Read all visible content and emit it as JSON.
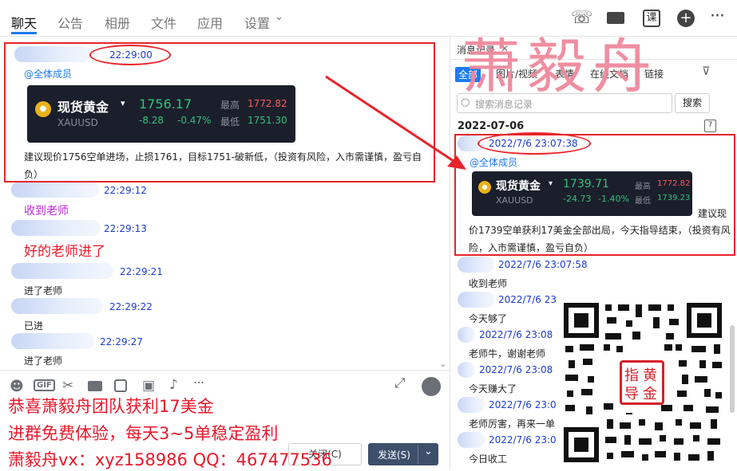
{
  "header": {
    "tabs": [
      "聊天",
      "公告",
      "相册",
      "文件",
      "应用",
      "设置"
    ],
    "settings_arrow": "⌄",
    "right_icons": {
      "call": "☏",
      "video": "▶",
      "lesson": "课",
      "add": "+",
      "more": "···"
    }
  },
  "chat": {
    "top_message": {
      "time": "22:29:00",
      "mention": "@全体成员",
      "card": {
        "name": "现货黄金",
        "code": "XAUUSD",
        "price": "1756.17",
        "change": "-8.28",
        "pct": "-0.47%",
        "high_label": "最高",
        "high": "1772.82",
        "low_label": "最低",
        "low": "1751.30"
      },
      "text": "建议现价1756空单进场，止损1761，目标1751-破新低，（投资有风险，入市需谨慎，盈亏自负）"
    },
    "messages": [
      {
        "time": "22:29:12",
        "text": "收到老师"
      },
      {
        "time": "22:29:13",
        "text": "好的老师进了"
      },
      {
        "time": "22:29:21",
        "text": "进了老师"
      },
      {
        "time": "22:29:22",
        "text": "已进"
      },
      {
        "time": "22:29:27",
        "text": "进了老师"
      }
    ]
  },
  "input_toolbar": {
    "icons": [
      "smiley-icon",
      "gif-icon",
      "scissors-icon",
      "folder-icon",
      "shake-icon",
      "image-icon",
      "bell-icon",
      "more-icon"
    ],
    "gif_label": "GIF",
    "close_label": "关闭(C)",
    "send_label": "发送(S)",
    "send_arrow": "⌄"
  },
  "promo": {
    "line1": "恭喜萧毅舟团队获利17美金",
    "line2": "进群免费体验，每天3~5单稳定盈利",
    "line3": "萧毅舟vx：xyz158986  QQ：467477536"
  },
  "history": {
    "title": "消息记录",
    "close": "✕",
    "tabs": [
      "全部",
      "图片/视频",
      "表情",
      "在线文档",
      "链接"
    ],
    "search_placeholder": "搜索消息记录",
    "search_button": "搜索",
    "date": "2022-07-06",
    "main_message": {
      "time": "2022/7/6 23:07:38",
      "mention": "@全体成员",
      "card": {
        "name": "现货黄金",
        "code": "XAUUSD",
        "price": "1739.71",
        "change": "-24.73",
        "pct": "-1.40%",
        "high_label": "最高",
        "high": "1772.82",
        "low_label": "最低",
        "low": "1739.23"
      },
      "text_part1": "建议现",
      "text_part2": "价1739空单获利17美金全部出局，今天指导结束，（投资有风险，入市需谨慎，盈亏自负）"
    },
    "messages": [
      {
        "time": "2022/7/6 23:07:58",
        "text": "收到老师"
      },
      {
        "time": "2022/7/6 23",
        "text": "今天够了"
      },
      {
        "time": "2022/7/6 23:08",
        "text": "老师牛，谢谢老师"
      },
      {
        "time": "2022/7/6 23:08",
        "text": "今天赚大了"
      },
      {
        "time": "2022/7/6 23:0",
        "text": "老师厉害，再来一单"
      },
      {
        "time": "2022/7/6 23:0",
        "text": "今日收工"
      }
    ]
  },
  "watermark": "萧毅舟",
  "stamp": "指导黄金"
}
